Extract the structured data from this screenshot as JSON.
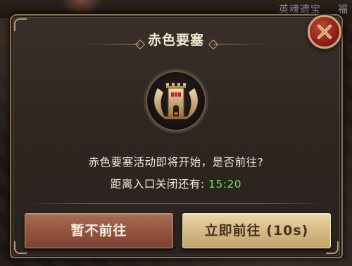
{
  "background": {
    "top_hint": "英魂遗宝",
    "top_hint_partial": "福"
  },
  "dialog": {
    "title": "赤色要塞",
    "message": "赤色要塞活动即将开始，是否前往?",
    "countdown_label": "距离入口关闭还有:",
    "countdown_value": "15:20",
    "close_icon": "close-x-icon",
    "emblem_icon": "fortress-tower-icon"
  },
  "buttons": {
    "cancel_label": "暂不前往",
    "confirm_label": "立即前往 (10s)"
  },
  "colors": {
    "countdown": "#6fe34f",
    "close_button": "#8e2018",
    "confirm_button": "#d6bb86",
    "cancel_button": "#93553f"
  }
}
